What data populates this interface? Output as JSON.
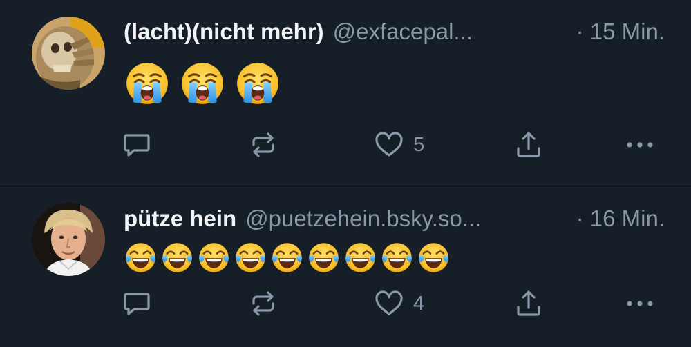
{
  "colors": {
    "background": "#161e27",
    "text_primary": "#f1f3f5",
    "text_secondary": "#8a99aa",
    "divider": "#2e3a48"
  },
  "posts": [
    {
      "display_name": "(lacht)(nicht mehr)",
      "handle": "@exfacepal...",
      "timestamp": "· 15 Min.",
      "emoji": [
        "loudly-crying-face",
        "loudly-crying-face",
        "loudly-crying-face"
      ],
      "avatar": "facepalm-skeleton-avatar",
      "like_count": "5"
    },
    {
      "display_name": "pütze hein",
      "handle": "@puetzehein.bsky.so...",
      "timestamp": "· 16 Min.",
      "emoji": [
        "tears-of-joy-face",
        "tears-of-joy-face",
        "tears-of-joy-face",
        "tears-of-joy-face",
        "tears-of-joy-face",
        "tears-of-joy-face",
        "tears-of-joy-face",
        "tears-of-joy-face",
        "tears-of-joy-face"
      ],
      "avatar": "portrait-photo-avatar",
      "like_count": "4"
    }
  ],
  "icons": {
    "reply": "speech-bubble-icon",
    "repost": "repost-arrows-icon",
    "like": "heart-icon",
    "share": "share-upload-icon",
    "more": "more-dots-icon"
  }
}
